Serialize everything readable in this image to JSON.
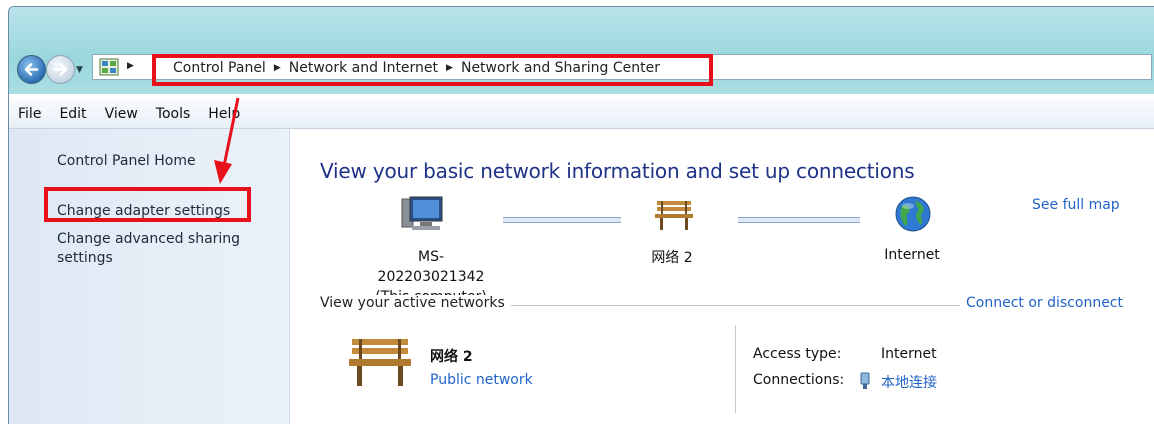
{
  "address_bar": {
    "crumbs": [
      "Control Panel",
      "Network and Internet",
      "Network and Sharing Center"
    ]
  },
  "menu": [
    "File",
    "Edit",
    "View",
    "Tools",
    "Help"
  ],
  "sidebar": {
    "items": [
      {
        "label": "Control Panel Home"
      },
      {
        "label": "Change adapter settings"
      },
      {
        "label": "Change advanced sharing settings"
      }
    ]
  },
  "main": {
    "heading": "View your basic network information and set up connections",
    "see_full_map": "See full map",
    "map": {
      "computer_name": "MS-202203021342",
      "computer_sub": "(This computer)",
      "network_name": "网络 2",
      "internet_label": "Internet"
    },
    "active_networks": {
      "title": "View your active networks",
      "connect_link": "Connect or disconnect",
      "network_name": "网络 2",
      "network_type": "Public network",
      "access_type_label": "Access type:",
      "access_type_value": "Internet",
      "connections_label": "Connections:",
      "connections_value": "本地连接"
    }
  },
  "colors": {
    "highlight": "#e8101a",
    "link": "#1f63c8",
    "heading": "#1e3287"
  },
  "icons": [
    "back-icon",
    "forward-icon",
    "control-panel-icon",
    "computer-icon",
    "bench-icon",
    "globe-icon",
    "network-adapter-icon"
  ]
}
